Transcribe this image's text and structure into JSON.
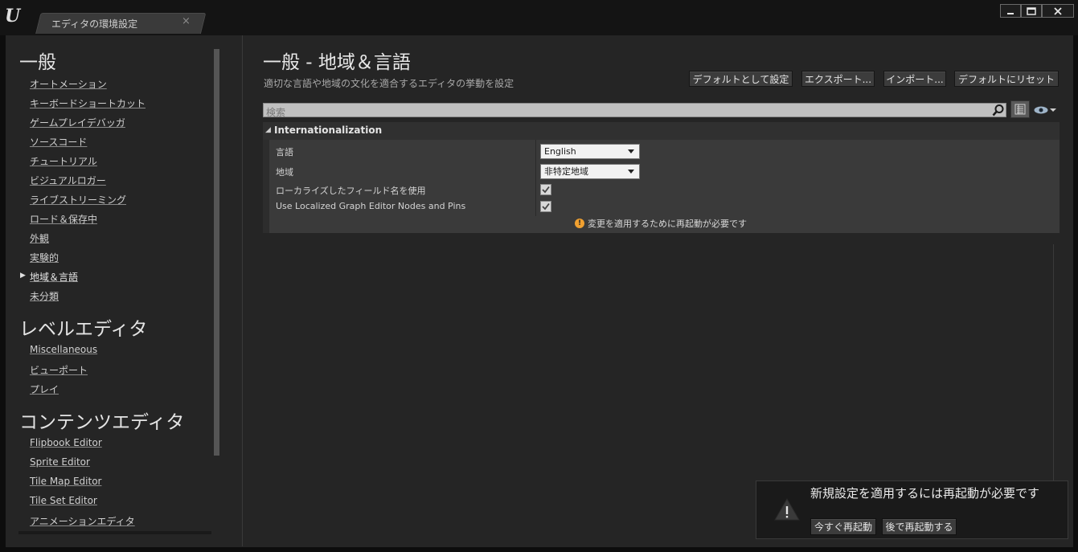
{
  "window": {
    "logo": "U",
    "tab_title": "エディタの環境設定",
    "tab_close": "×",
    "controls": {
      "minimize": "▁",
      "maximize": "▭",
      "close": "✕"
    }
  },
  "sidebar": {
    "categories": [
      {
        "title": "一般",
        "items": [
          "オートメーション",
          "キーボードショートカット",
          "ゲームプレイデバッガ",
          "ソースコード",
          "チュートリアル",
          "ビジュアルロガー",
          "ライブストリーミング",
          "ロード＆保存中",
          "外観",
          "実験的",
          "地域＆言語",
          "未分類"
        ]
      },
      {
        "title": "レベルエディタ",
        "items": [
          "Miscellaneous",
          "ビューポート",
          "プレイ"
        ]
      },
      {
        "title": "コンテンツエディタ",
        "items": [
          "Flipbook Editor",
          "Sprite Editor",
          "Tile Map Editor",
          "Tile Set Editor",
          "アニメーションエディタ"
        ]
      }
    ],
    "active_item": "地域＆言語",
    "active_marker": "▶"
  },
  "content": {
    "title": "一般 - 地域＆言語",
    "description": "適切な言語や地域の文化を適合するエディタの挙動を設定",
    "buttons": {
      "set_default": "デフォルトとして設定",
      "export": "エクスポート...",
      "import": "インポート...",
      "reset_default": "デフォルトにリセット"
    },
    "search_placeholder": "検索",
    "section": {
      "arrow": "◢",
      "title": "Internationalization",
      "rows": {
        "language_label": "言語",
        "language_value": "English",
        "region_label": "地域",
        "region_value": "非特定地域",
        "localized_fields_label": "ローカライズしたフィールド名を使用",
        "localized_fields_checked": true,
        "localized_graph_label": "Use Localized Graph Editor Nodes and Pins",
        "localized_graph_checked": true
      },
      "warning_icon": "!",
      "warning": "変更を適用するために再起動が必要です"
    }
  },
  "notification": {
    "icon": "warning-icon",
    "text": "新規設定を適用するには再起動が必要です",
    "restart_now": "今すぐ再起動",
    "restart_later": "後で再起動する"
  },
  "colors": {
    "background": "#252525",
    "warning": "#f0a030"
  }
}
